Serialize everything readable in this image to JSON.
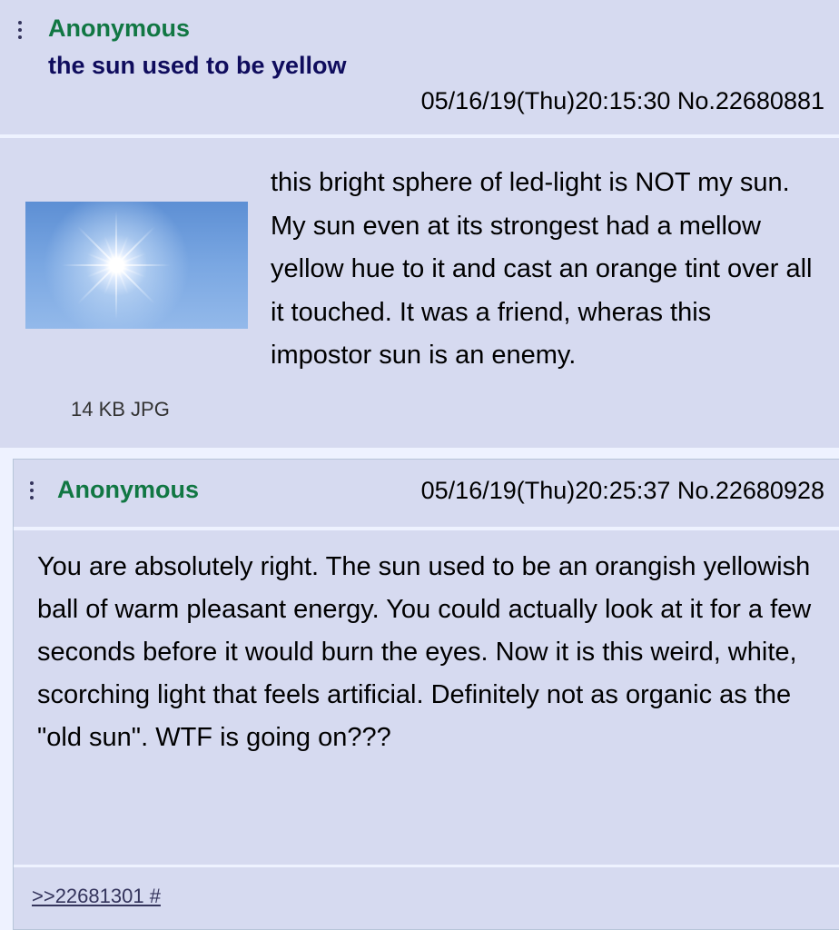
{
  "op": {
    "name": "Anonymous",
    "subject": "the sun used to be yellow",
    "meta": "05/16/19(Thu)20:15:30 No.22680881",
    "file_info": "14 KB JPG",
    "text": "this bright sphere of led-light is NOT my sun. My sun even at its strongest had a mellow yellow hue to it and cast an orange tint over all it touched. It was a friend, wheras this impostor sun is an enemy."
  },
  "reply": {
    "name": "Anonymous",
    "meta": "05/16/19(Thu)20:25:37 No.22680928",
    "text": "You are absolutely right. The sun used to be an orangish yellowish ball of warm pleasant energy. You could actually look at it for a few seconds before it would burn the eyes. Now it is this weird, white, scorching light that feels artificial. Definitely not as organic as the \"old sun\". WTF is going on???",
    "backlink": ">>22681301 #"
  },
  "icons": {
    "post_menu": "vertical-dots-icon",
    "thumbnail": "sun-image"
  },
  "colors": {
    "post_bg": "#d6daf0",
    "page_bg": "#eef2ff",
    "name": "#117743",
    "subject": "#0f0c5d"
  }
}
